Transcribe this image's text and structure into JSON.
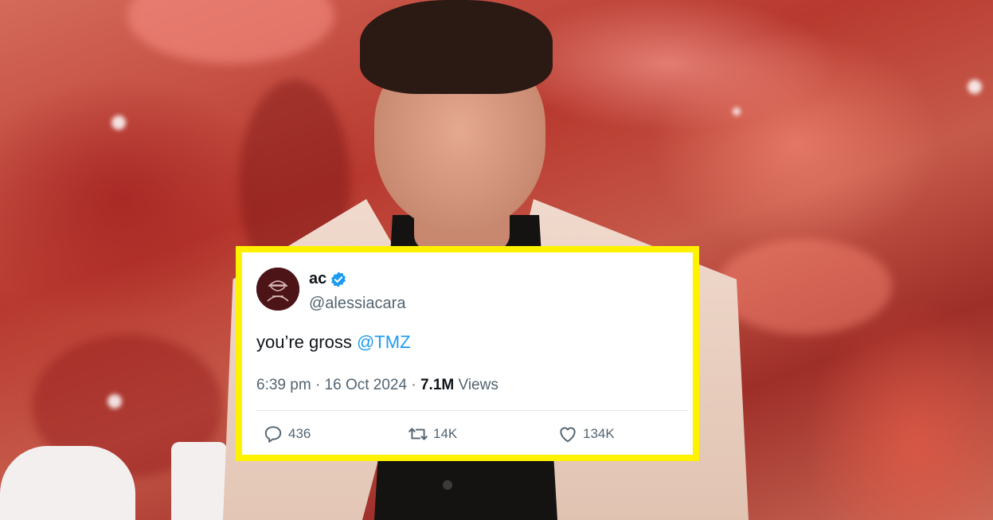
{
  "tweet": {
    "display_name": "ac",
    "handle": "@alessiacara",
    "text": "you’re gross",
    "mention": "@TMZ",
    "time": "6:39 pm",
    "date": "16 Oct 2024",
    "views_count": "7.1M",
    "views_label": "Views",
    "verified_icon": "verified-badge-icon",
    "accent_color": "#1d9bf0",
    "frame_color": "#fff200",
    "actions": {
      "replies": "436",
      "reposts": "14K",
      "likes": "134K"
    }
  }
}
